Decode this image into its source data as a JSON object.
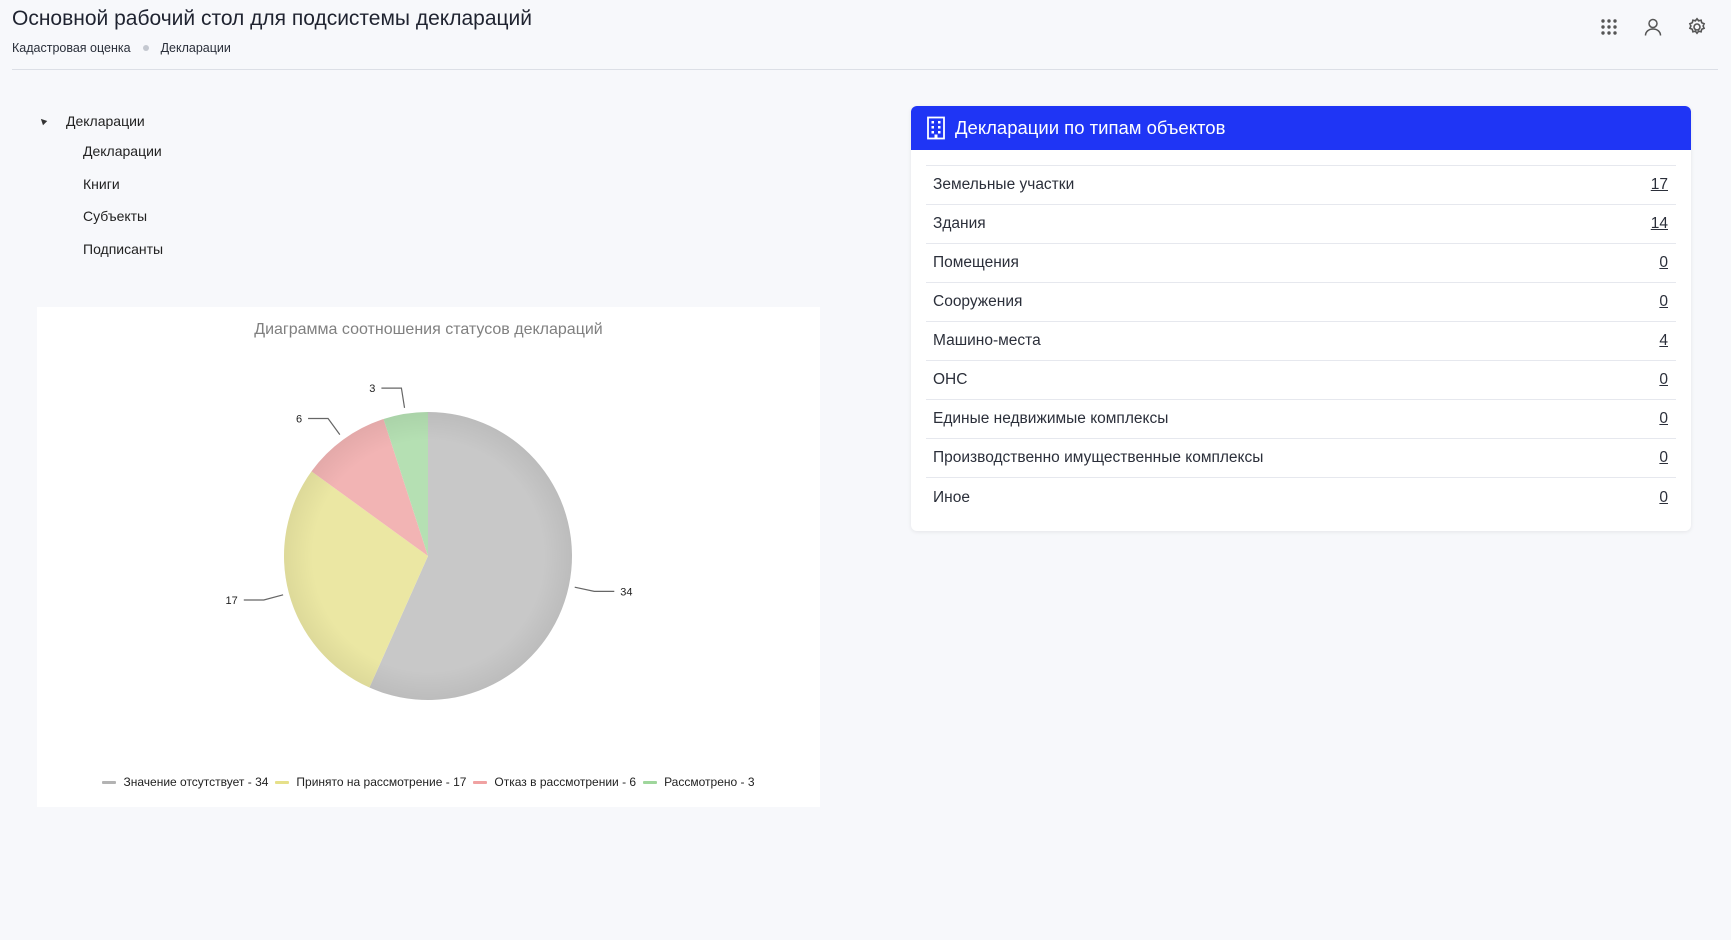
{
  "header": {
    "title": "Основной рабочий стол для подсистемы деклараций",
    "breadcrumb": [
      "Кадастровая оценка",
      "Декларации"
    ],
    "icons": [
      "apps-grid-icon",
      "user-icon",
      "settings-gear-icon"
    ]
  },
  "tree": {
    "root": "Декларации",
    "children": [
      "Декларации",
      "Книги",
      "Субъекты",
      "Подписанты"
    ]
  },
  "types": {
    "title": "Декларации по типам объектов",
    "header_color": "#1f35f5",
    "rows": [
      {
        "label": "Земельные участки",
        "count": "17"
      },
      {
        "label": "Здания",
        "count": "14"
      },
      {
        "label": "Помещения",
        "count": "0"
      },
      {
        "label": "Сооружения",
        "count": "0"
      },
      {
        "label": "Машино-места",
        "count": "4"
      },
      {
        "label": "ОНС",
        "count": "0"
      },
      {
        "label": "Единые недвижимые комплексы",
        "count": "0"
      },
      {
        "label": "Производственно имущественные комплексы",
        "count": "0"
      },
      {
        "label": "Иное",
        "count": "0"
      }
    ]
  },
  "chart_data": {
    "type": "pie",
    "title": "Диаграмма соотношения статусов деклараций",
    "slices": [
      {
        "name": "Значение отсутствует",
        "value": 34,
        "color": "#c8c8c8",
        "legend": "Значение отсутствует - 34"
      },
      {
        "name": "Принято на рассмотрение",
        "value": 17,
        "color": "#ebe7a3",
        "legend": "Принято на рассмотрение - 17"
      },
      {
        "name": "Отказ в рассмотрении",
        "value": 6,
        "color": "#f2b4b4",
        "legend": "Отказ в рассмотрении - 6"
      },
      {
        "name": "Рассмотрено",
        "value": 3,
        "color": "#b5e0b3",
        "legend": "Рассмотрено - 3"
      }
    ],
    "legend_placement": "bottom"
  }
}
